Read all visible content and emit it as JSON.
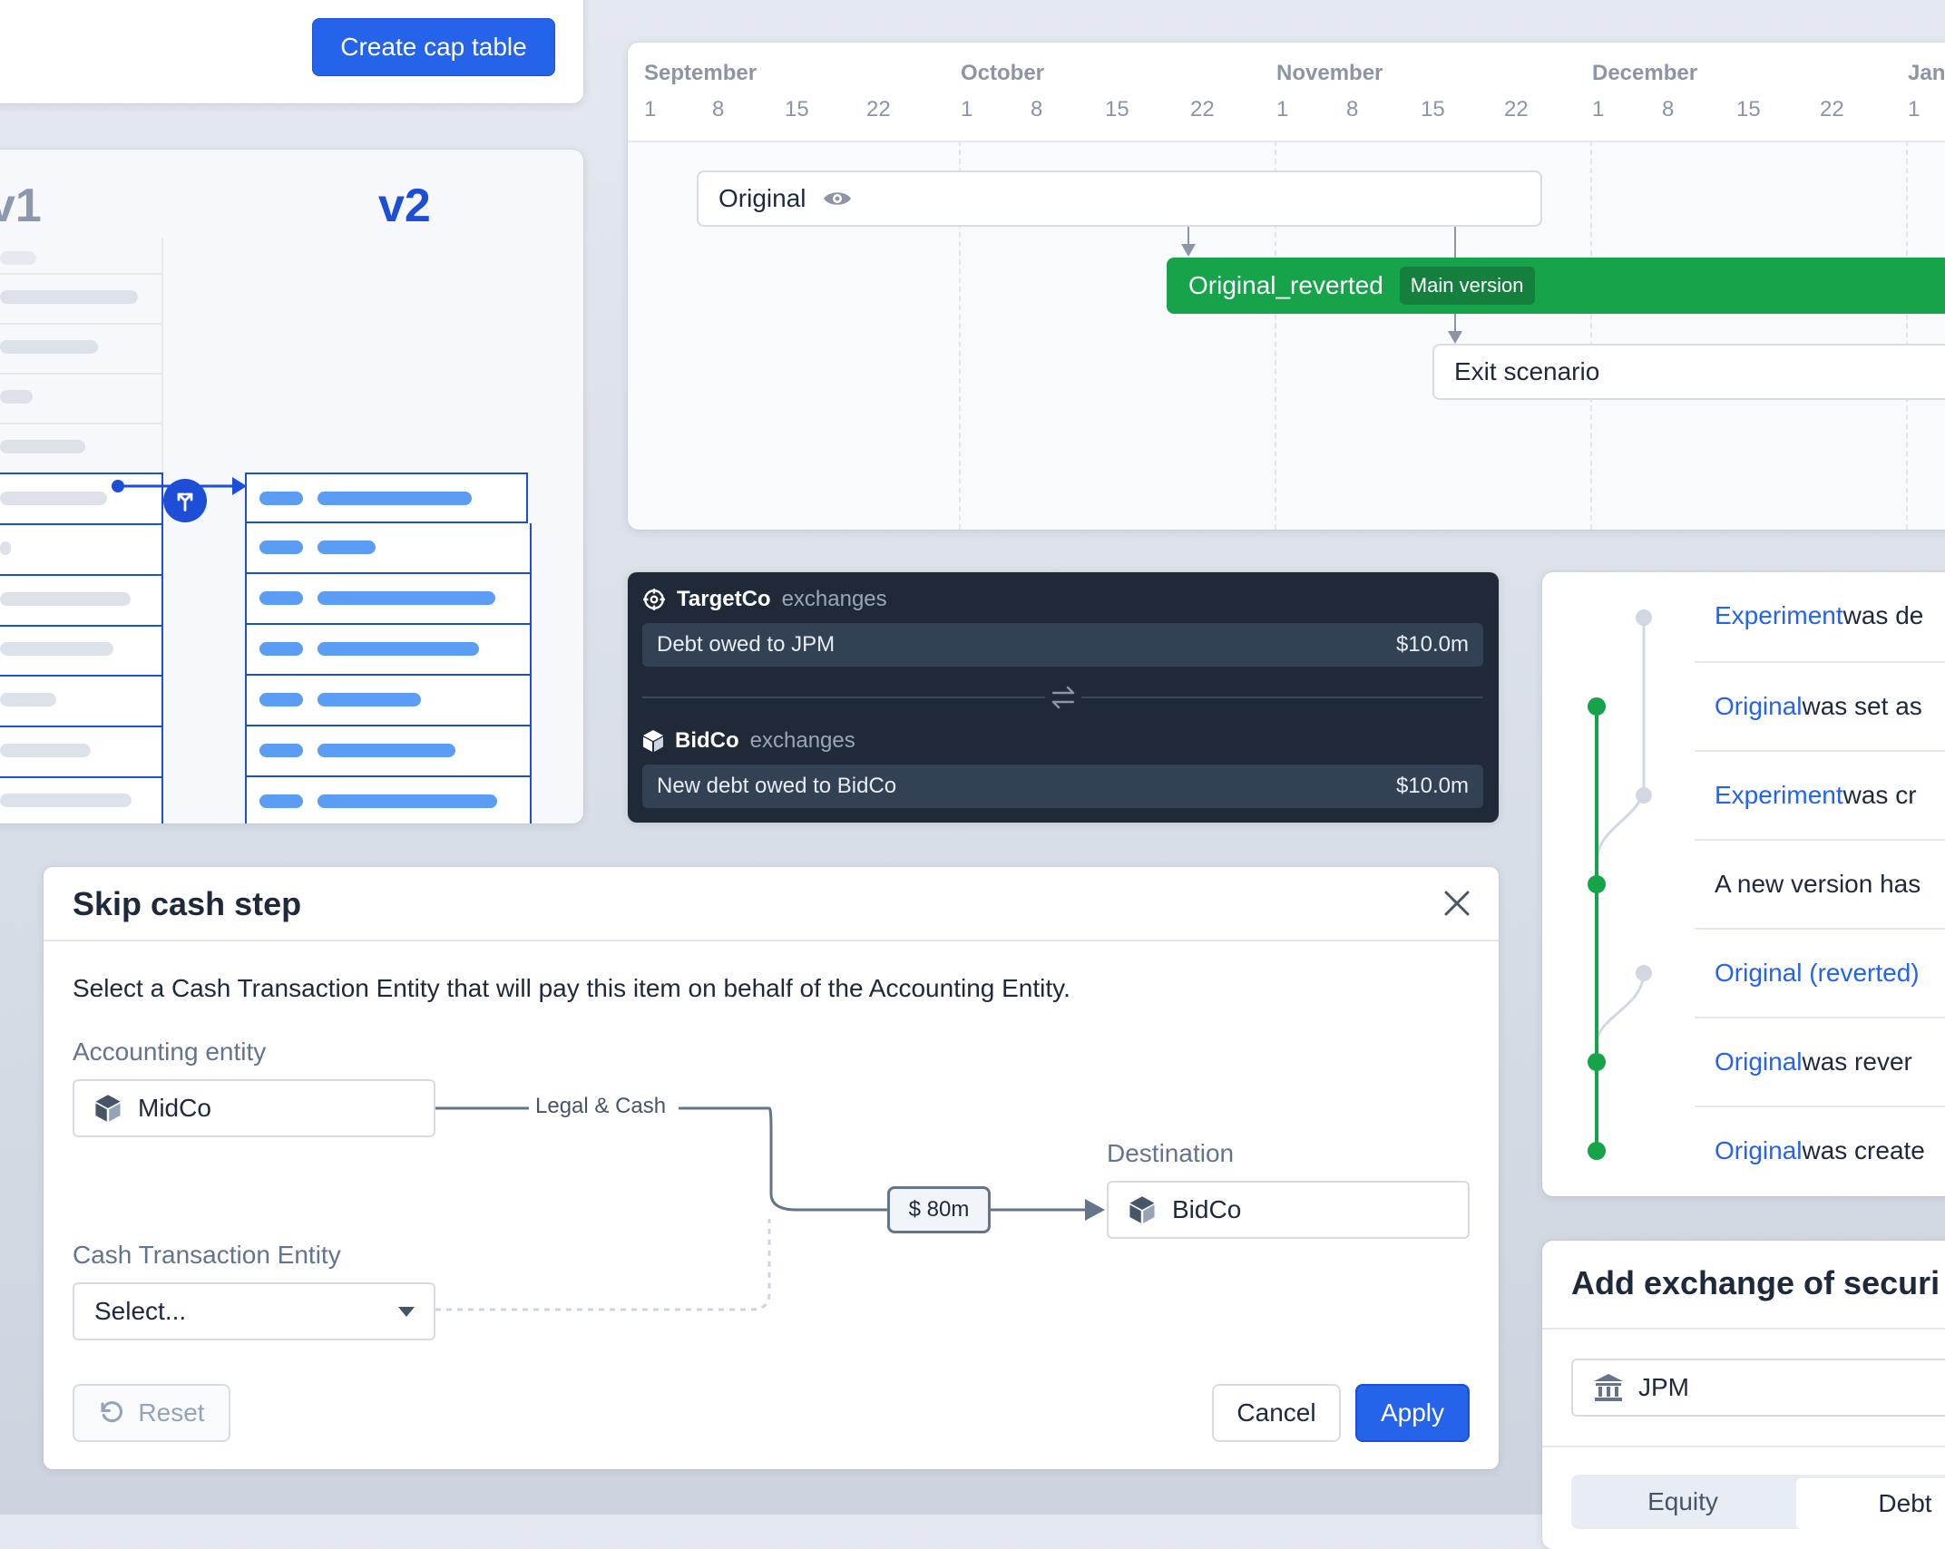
{
  "cap_table": {
    "create_label": "Create cap table"
  },
  "versions": {
    "v1": "v1",
    "v2": "v2"
  },
  "timeline": {
    "months": [
      "September",
      "October",
      "November",
      "December",
      "Jan"
    ],
    "days": [
      "1",
      "8",
      "15",
      "22",
      "1",
      "8",
      "15",
      "22",
      "1",
      "8",
      "15",
      "22",
      "1",
      "8",
      "15",
      "22",
      "1"
    ],
    "original_label": "Original",
    "reverted_label": "Original_reverted",
    "main_badge": "Main version",
    "exit_label": "Exit scenario",
    "colors": {
      "main": "#16a34a",
      "main_badge": "#15803d"
    }
  },
  "exchange": {
    "top_entity": "TargetCo",
    "top_sub": "exchanges",
    "top_item": "Debt owed to JPM",
    "top_amount": "$10.0m",
    "bottom_entity": "BidCo",
    "bottom_sub": "exchanges",
    "bottom_item": "New debt owed to BidCo",
    "bottom_amount": "$10.0m"
  },
  "history": {
    "items": [
      {
        "link": "Experiment",
        "rest": " was de"
      },
      {
        "link": "Original",
        "rest": " was set as"
      },
      {
        "link": "Experiment",
        "rest": " was cr"
      },
      {
        "link": "",
        "rest": "A new version has"
      },
      {
        "link": "Original (reverted)",
        "rest": ""
      },
      {
        "link": "Original",
        "rest": " was rever"
      },
      {
        "link": "Original",
        "rest": " was create"
      }
    ]
  },
  "modal": {
    "title": "Skip cash step",
    "description": "Select a Cash Transaction Entity that will pay this item on behalf of the Accounting Entity.",
    "accounting_label": "Accounting entity",
    "accounting_value": "MidCo",
    "edge_label": "Legal & Cash",
    "amount": "$ 80m",
    "destination_label": "Destination",
    "destination_value": "BidCo",
    "cash_entity_label": "Cash Transaction Entity",
    "cash_entity_placeholder": "Select...",
    "reset_label": "Reset",
    "cancel_label": "Cancel",
    "apply_label": "Apply"
  },
  "add_exchange": {
    "title": "Add exchange of securi",
    "entity": "JPM",
    "tabs": [
      "Equity",
      "Debt"
    ]
  }
}
